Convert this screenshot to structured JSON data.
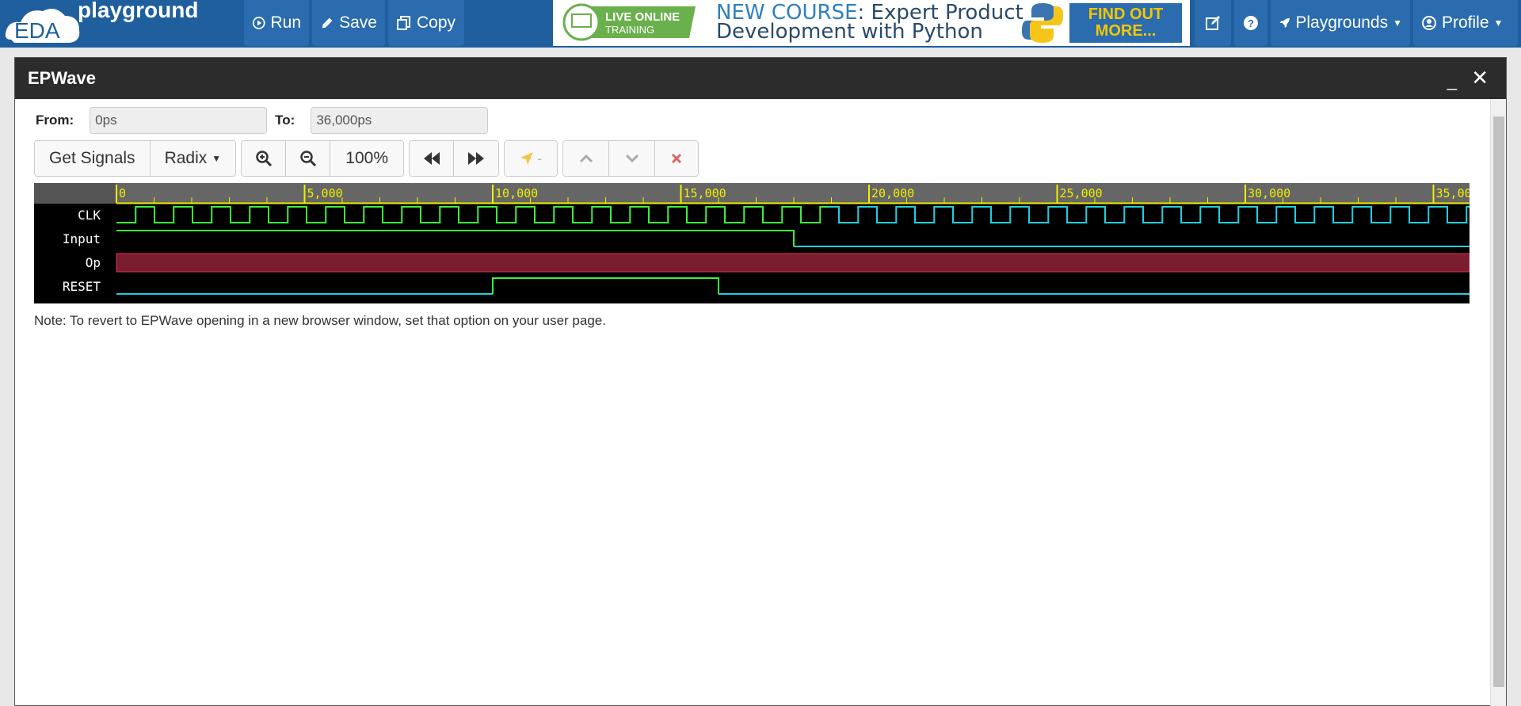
{
  "nav": {
    "brand_short": "EDA",
    "brand_long": "playground",
    "run_label": "Run",
    "save_label": "Save",
    "copy_label": "Copy",
    "playgrounds_label": "Playgrounds",
    "profile_label": "Profile"
  },
  "banner": {
    "badge_line1": "LIVE ONLINE",
    "badge_line2": "TRAINING",
    "headline_hl": "NEW COURSE",
    "headline_rest": ": Expert Product",
    "headline_line2": "Development with Python",
    "cta_line1": "FIND OUT",
    "cta_line2": "MORE..."
  },
  "modal": {
    "title": "EPWave",
    "minimize": "_",
    "close": "✕"
  },
  "range": {
    "from_label": "From:",
    "from_value": "0ps",
    "to_label": "To:",
    "to_value": "36,000ps"
  },
  "toolbar": {
    "get_signals": "Get Signals",
    "radix": "Radix",
    "zoom_level": "100%",
    "cursor_value": "-"
  },
  "waveform": {
    "ruler_ticks": [
      "0",
      "5,000",
      "10,000",
      "15,000",
      "20,000",
      "25,000",
      "30,000",
      "35,00"
    ],
    "signals": [
      {
        "name": "CLK"
      },
      {
        "name": "Input"
      },
      {
        "name": "Op"
      },
      {
        "name": "RESET"
      }
    ]
  },
  "note": "Note: To revert to EPWave opening in a new browser window, set that option on your user page.",
  "colors": {
    "nav_bg": "#1f5f9e",
    "wave_green": "#3cf03c",
    "wave_cyan": "#1ed0e0",
    "wave_red_bus": "#7a1d2e",
    "ruler_yellow": "#f0f000"
  }
}
